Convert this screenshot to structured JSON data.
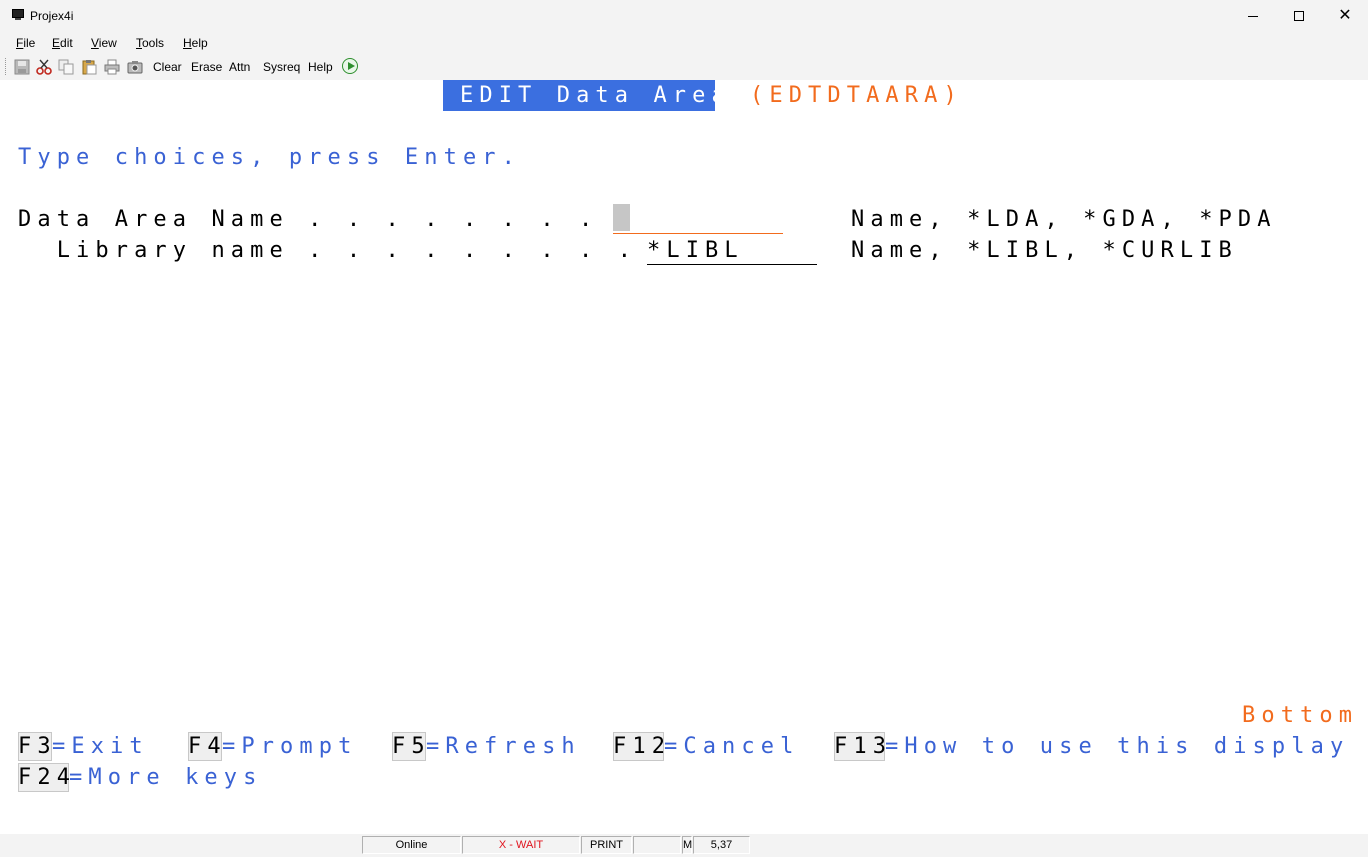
{
  "window": {
    "title": "Projex4i"
  },
  "menu": {
    "items": [
      {
        "label": "File",
        "accel": "F",
        "rest": "ile"
      },
      {
        "label": "Edit",
        "accel": "E",
        "rest": "dit"
      },
      {
        "label": "View",
        "accel": "V",
        "rest": "iew"
      },
      {
        "label": "Tools",
        "accel": "T",
        "rest": "ools"
      },
      {
        "label": "Help",
        "accel": "H",
        "rest": "elp"
      }
    ]
  },
  "toolbar": {
    "icons": [
      "save-icon",
      "cut-icon",
      "copy-icon",
      "paste-icon",
      "print-icon",
      "camera-icon"
    ],
    "clear_label": "Clear",
    "erase_label": "Erase",
    "attn_label": "Attn",
    "sysreq_label": "Sysreq",
    "help_label": "Help",
    "run_icon": "play-icon"
  },
  "screen": {
    "title": "EDIT Data Area",
    "command": "(EDTDTAARA)",
    "instruction": "Type choices, press Enter.",
    "fields": [
      {
        "label": "Data Area Name . . . . . . . . .",
        "value": "",
        "hint": "Name, *LDA, *GDA, *PDA"
      },
      {
        "label": "  Library name . . . . . . . . .",
        "value": "*LIBL",
        "hint": "Name, *LIBL, *CURLIB"
      }
    ],
    "more_indicator": "Bottom",
    "function_keys": [
      {
        "key": "F3",
        "text": "=Exit"
      },
      {
        "key": "F4",
        "text": "=Prompt"
      },
      {
        "key": "F5",
        "text": "=Refresh"
      },
      {
        "key": "F12",
        "text": "=Cancel"
      },
      {
        "key": "F13",
        "text": "=How to use this display"
      },
      {
        "key": "F24",
        "text": "=More keys"
      }
    ]
  },
  "status": {
    "connection": "Online",
    "wait": "X - WAIT",
    "print": "PRINT",
    "blank": "",
    "mode": "M",
    "cursor_pos": "5,37"
  },
  "colors": {
    "screen_blue": "#3a62d4",
    "title_bg": "#3b6fe0",
    "orange": "#f26b1d",
    "status_red": "#e0141e"
  }
}
